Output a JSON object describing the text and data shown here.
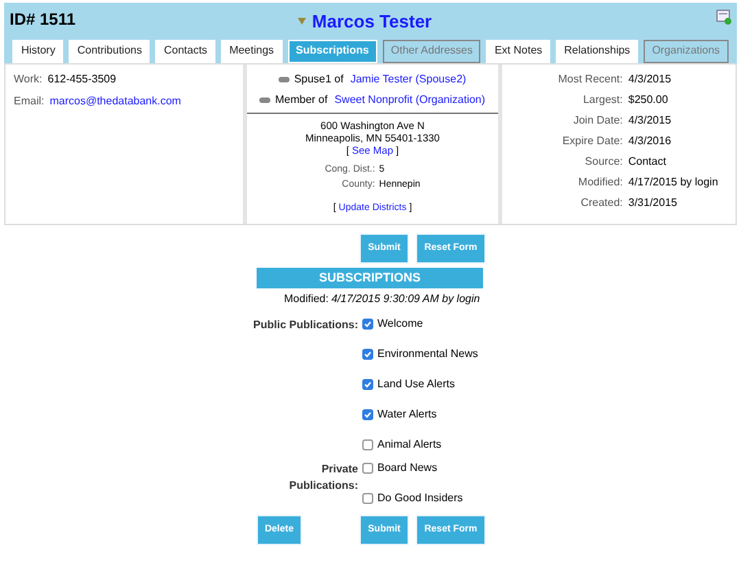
{
  "header": {
    "id_label": "ID# 1511",
    "name": "Marcos Tester"
  },
  "tabs": [
    {
      "label": "History",
      "selected": false,
      "disabled": false
    },
    {
      "label": "Contributions",
      "selected": false,
      "disabled": false
    },
    {
      "label": "Contacts",
      "selected": false,
      "disabled": false
    },
    {
      "label": "Meetings",
      "selected": false,
      "disabled": false
    },
    {
      "label": "Subscriptions",
      "selected": true,
      "disabled": false
    },
    {
      "label": "Other Addresses",
      "selected": false,
      "disabled": true
    },
    {
      "label": "Ext Notes",
      "selected": false,
      "disabled": false
    },
    {
      "label": "Relationships",
      "selected": false,
      "disabled": false
    },
    {
      "label": "Organizations",
      "selected": false,
      "disabled": true
    }
  ],
  "contact": [
    {
      "label": "Work:",
      "value": "612-455-3509",
      "kind": "text"
    },
    {
      "label": "Email:",
      "value": "marcos@thedatabank.com",
      "kind": "link"
    }
  ],
  "relations": [
    {
      "prefix": "Spuse1 of",
      "link": "Jamie Tester (Spouse2)"
    },
    {
      "prefix": "Member of",
      "link": "Sweet Nonprofit (Organization)"
    }
  ],
  "address": {
    "line1": "600 Washington Ave N",
    "line2": "Minneapolis, MN 55401-1330",
    "open_bracket": "[",
    "map_link": "See Map",
    "close_bracket": "]",
    "districts": [
      {
        "label": "Cong. Dist.:",
        "value": "5"
      },
      {
        "label": "County:",
        "value": "Hennepin"
      }
    ],
    "update_open": "[",
    "update_link": "Update Districts",
    "update_close": "]"
  },
  "stats": [
    {
      "label": "Most Recent:",
      "value": "4/3/2015"
    },
    {
      "label": "Largest:",
      "value": "$250.00"
    },
    {
      "label": "Join Date:",
      "value": "4/3/2015"
    },
    {
      "label": "Expire Date:",
      "value": "4/3/2016"
    },
    {
      "label": "Source:",
      "value": "Contact"
    },
    {
      "label": "Modified:",
      "value": "4/17/2015 by login"
    },
    {
      "label": "Created:",
      "value": "3/31/2015"
    }
  ],
  "top_buttons": [
    "Submit",
    "Reset Form"
  ],
  "subscriptions": {
    "title": "SUBSCRIPTIONS",
    "modified_label": "Modified:",
    "modified_value": "4/17/2015 9:30:09 AM by login",
    "groups": [
      {
        "label": "Public Publications:",
        "items": [
          {
            "label": "Welcome",
            "checked": true
          },
          {
            "label": "Environmental News",
            "checked": true
          },
          {
            "label": "Land Use Alerts",
            "checked": true
          },
          {
            "label": "Water Alerts",
            "checked": true
          },
          {
            "label": "Animal Alerts",
            "checked": false
          }
        ]
      },
      {
        "label": "Private Publications:",
        "items": [
          {
            "label": "Board News",
            "checked": false
          },
          {
            "label": "Do Good Insiders",
            "checked": false
          }
        ]
      }
    ]
  },
  "bottom_buttons": {
    "delete": "Delete",
    "actions": [
      "Submit",
      "Reset Form"
    ]
  }
}
